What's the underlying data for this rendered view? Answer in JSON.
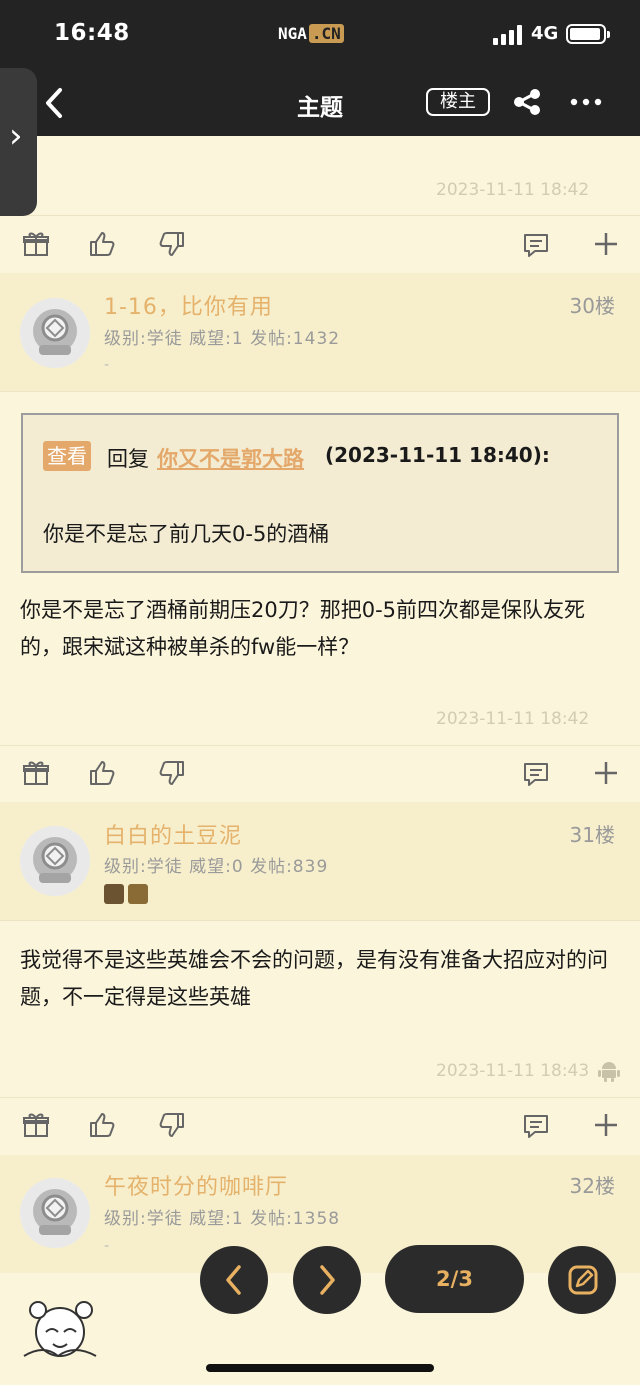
{
  "status_bar": {
    "time": "16:48",
    "app_logo": "NGA",
    "app_logo_cn": ".CN",
    "network": "4G"
  },
  "nav": {
    "title": "主题",
    "author_filter": "楼主"
  },
  "top_post": {
    "timestamp": "2023-11-11 18:42"
  },
  "posts": [
    {
      "username": "1-16，比你有用",
      "floor": "30楼",
      "meta": "级别:学徒   威望:1   发帖:1432",
      "sub": "-",
      "quote": {
        "tag": "查看",
        "reply_label": "回复",
        "user": "你又不是郭大路",
        "time": "(2023-11-11 18:40):",
        "text": "你是不是忘了前几天0-5的酒桶"
      },
      "content": "你是不是忘了酒桶前期压20刀？那把0-5前四次都是保队友死的，跟宋斌这种被单杀的fw能一样？",
      "timestamp": "2023-11-11 18:42"
    },
    {
      "username": "白白的土豆泥",
      "floor": "31楼",
      "meta": "级别:学徒   威望:0   发帖:839",
      "content": "我觉得不是这些英雄会不会的问题，是有没有准备大招应对的问题，不一定得是这些英雄",
      "timestamp": "2023-11-11 18:43"
    },
    {
      "username": "午夜时分的咖啡厅",
      "floor": "32楼",
      "meta": "级别:学徒   威望:1   发帖:1358",
      "sub": "-"
    }
  ],
  "pager": {
    "indicator": "2/3"
  },
  "bottom_peek": "…",
  "colors": {
    "accent": "#e3a86a",
    "bar": "#232323",
    "bg": "#fbf5dc"
  }
}
